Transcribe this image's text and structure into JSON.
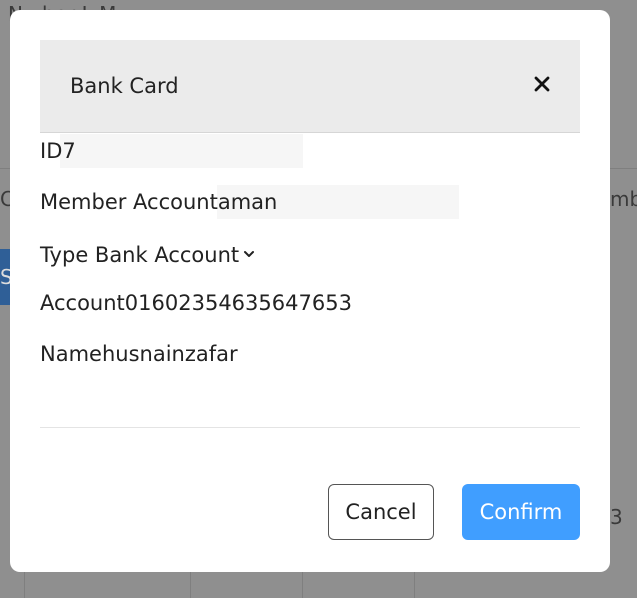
{
  "background": {
    "fragment_top": "Nu  ber  L  M",
    "fragment_left": "C",
    "fragment_right": "mb",
    "fragment_button": "Se",
    "fragment_number": "3"
  },
  "modal": {
    "title": "Bank Card",
    "close_icon": "close-icon",
    "fields": {
      "id_label": "ID",
      "id_value": "7",
      "member_label": "Member Account",
      "member_value": "aman",
      "type_label": "Type Bank Account",
      "account_label": "Account",
      "account_value": "01602354635647653",
      "name_label": "Name",
      "name_value": "husnainzafar"
    },
    "buttons": {
      "cancel": "Cancel",
      "confirm": "Confirm"
    }
  },
  "colors": {
    "overlay": "#8f8f8f",
    "header_bg": "#ebebeb",
    "confirm_bg": "#409eff"
  }
}
